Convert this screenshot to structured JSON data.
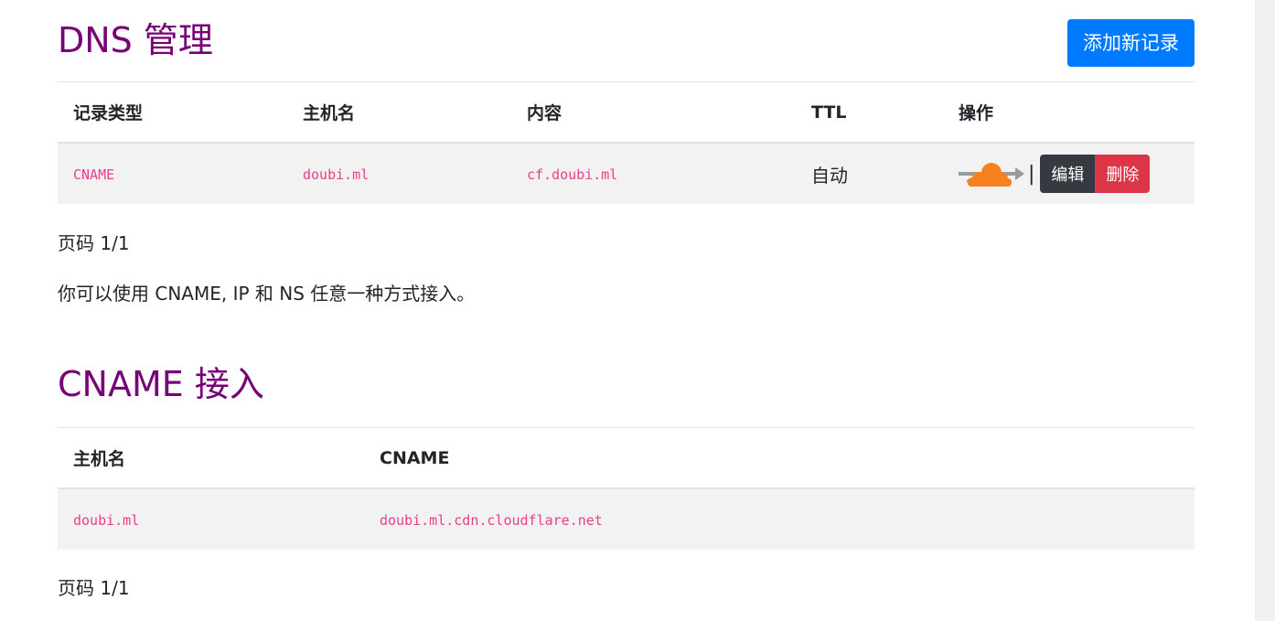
{
  "dns_section": {
    "title": "DNS 管理",
    "add_button": "添加新记录",
    "columns": [
      "记录类型",
      "主机名",
      "内容",
      "TTL",
      "操作"
    ],
    "rows": [
      {
        "type": "CNAME",
        "host": "doubi.ml",
        "content": "cf.doubi.ml",
        "ttl": "自动",
        "separator": "|",
        "edit_label": "编辑",
        "delete_label": "删除"
      }
    ],
    "pagination": "页码 1/1",
    "note": "你可以使用 CNAME, IP 和 NS 任意一种方式接入。"
  },
  "cname_section": {
    "title": "CNAME 接入",
    "columns": [
      "主机名",
      "CNAME"
    ],
    "rows": [
      {
        "host": "doubi.ml",
        "cname": "doubi.ml.cdn.cloudflare.net"
      }
    ],
    "pagination": "页码 1/1"
  },
  "icons": {
    "proxy_toggle": "cloudflare-proxied-cloud-icon"
  },
  "colors": {
    "title": "#770077",
    "primary": "#007bff",
    "dark": "#343a40",
    "danger": "#dc3545",
    "code": "#e83e8c",
    "cloud": "#f6821f"
  }
}
